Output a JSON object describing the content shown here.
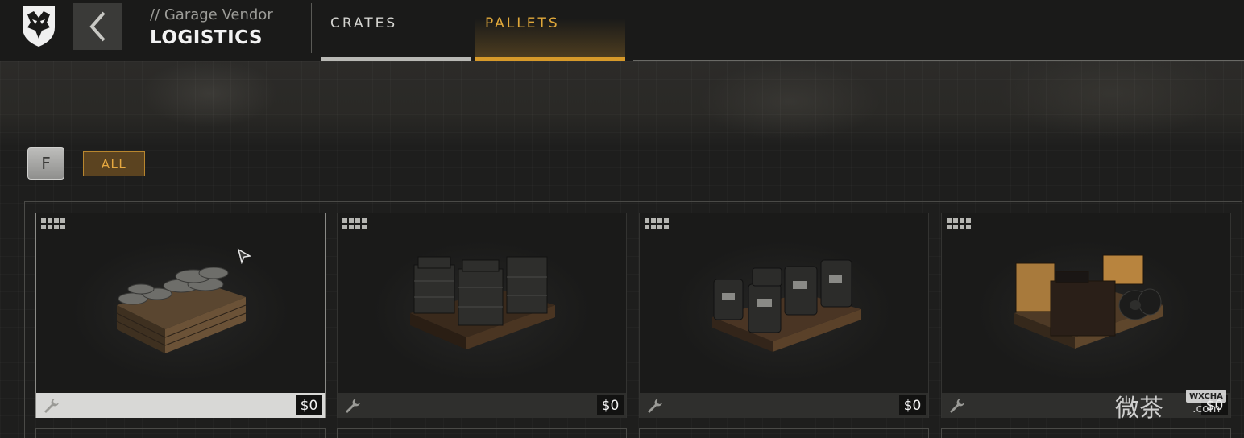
{
  "header": {
    "vendor_subtitle": "// Garage Vendor",
    "vendor_title": "LOGISTICS",
    "tabs": [
      {
        "label": "CRATES",
        "active": false
      },
      {
        "label": "PALLETS",
        "active": true
      }
    ]
  },
  "filters": {
    "key_label": "F",
    "hint": "",
    "all_label": "ALL"
  },
  "items": [
    {
      "price": "$0",
      "selected": true
    },
    {
      "price": "$0",
      "selected": false
    },
    {
      "price": "$0",
      "selected": false
    },
    {
      "price": "$0",
      "selected": false
    }
  ],
  "watermark": {
    "text": "微茶",
    "badge": "WXCHA",
    "suffix": ".com"
  },
  "colors": {
    "accent": "#d79a2a",
    "accent_text": "#e6a840",
    "background": "#1e1e1d"
  },
  "icons": [
    "shield-wolf-logo-icon",
    "chevron-left-icon",
    "grid-icon",
    "wrench-icon",
    "cursor-icon"
  ]
}
